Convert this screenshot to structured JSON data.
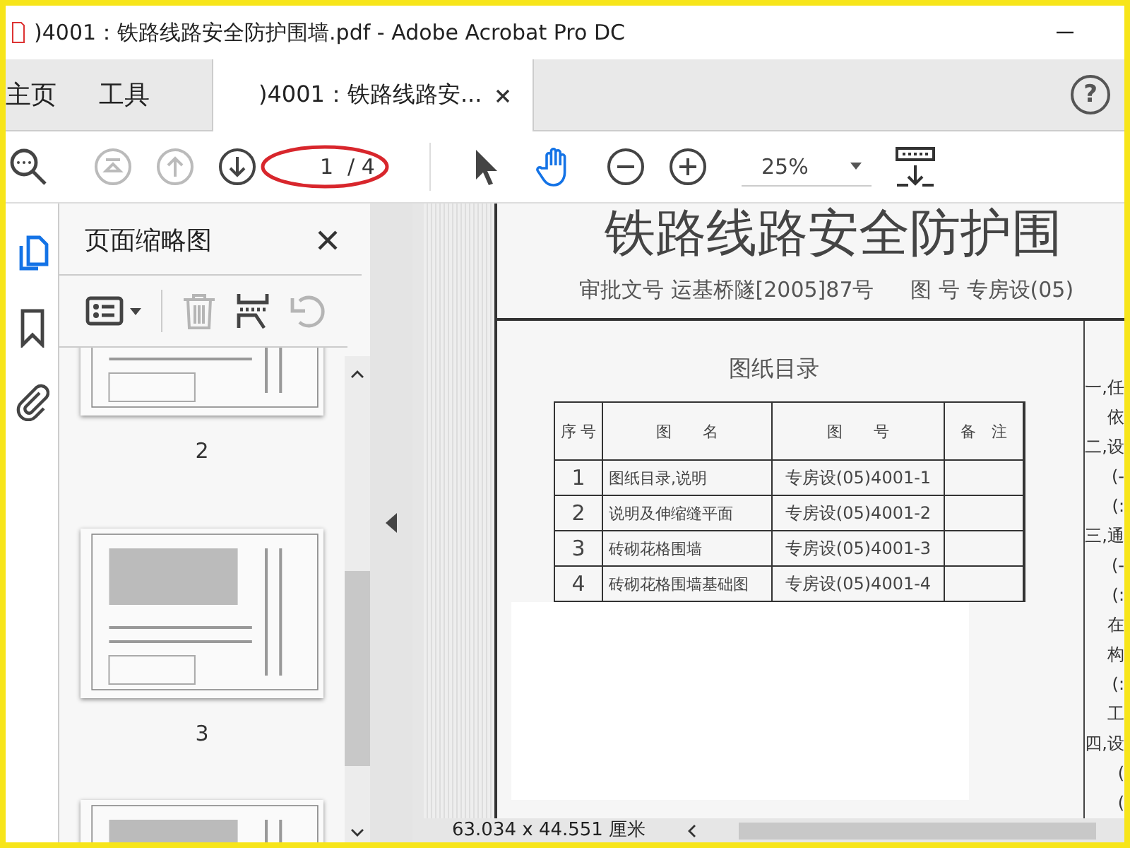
{
  "window": {
    "title": ")4001：铁路线路安全防护围墙.pdf - Adobe Acrobat Pro DC"
  },
  "tabs": [
    {
      "label": "主页",
      "kind": "nav",
      "selected": false
    },
    {
      "label": "工具",
      "kind": "nav",
      "selected": false
    },
    {
      "label": ")4001：铁路线路安...",
      "kind": "doc",
      "selected": true
    }
  ],
  "help_button": {
    "label": "?"
  },
  "toolbar": {
    "tools": [
      {
        "kind": "search",
        "disabled": false
      },
      {
        "kind": "first",
        "disabled": true
      },
      {
        "kind": "prev",
        "disabled": true
      },
      {
        "kind": "next",
        "disabled": false
      }
    ],
    "page_field": {
      "value": "1"
    },
    "page_total": "/ 4",
    "pointers": [
      {
        "kind": "select",
        "selected": false
      },
      {
        "kind": "hand",
        "selected": true
      }
    ],
    "zoom_buttons": [
      {
        "kind": "out"
      },
      {
        "kind": "in"
      }
    ],
    "zoom": "25%"
  },
  "rail": [
    {
      "kind": "pages",
      "selected": true
    },
    {
      "kind": "bookmarks",
      "selected": false
    },
    {
      "kind": "attachments",
      "selected": false
    }
  ],
  "panel": {
    "title": "页面缩略图",
    "tools": [
      {
        "kind": "options",
        "disabled": false
      },
      {
        "kind": "delete",
        "disabled": true
      },
      {
        "kind": "insert",
        "disabled": false
      },
      {
        "kind": "rotate",
        "disabled": true
      }
    ],
    "thumbnails": [
      {
        "label": "2",
        "selected": false
      },
      {
        "label": "3",
        "selected": false
      },
      {
        "selected": false
      }
    ]
  },
  "document": {
    "title": "铁路线路安全防护围",
    "approval": "审批文号  运基桥隧[2005]87号",
    "drawing_no": "图  号  专房设(05)",
    "table_title": "图纸目录",
    "table": {
      "columns": [
        "序 号",
        "图　　名",
        "图　　号",
        "备　注"
      ],
      "rows": [
        [
          "1",
          "图纸目录,说明",
          "专房设(05)4001-1"
        ],
        [
          "2",
          "说明及伸缩缝平面",
          "专房设(05)4001-2"
        ],
        [
          "3",
          "砖砌花格围墙",
          "专房设(05)4001-3"
        ],
        [
          "4",
          "砖砌花格围墙基础图",
          "专房设(05)4001-4"
        ]
      ]
    },
    "margin_notes": [
      "一,任",
      "依",
      "二,设",
      "(-",
      "(:",
      "三,通",
      "(-",
      "(:",
      "在",
      "构",
      "(:",
      "工",
      "四,设",
      "(",
      "("
    ]
  },
  "status": {
    "page_size": "63.034 x 44.551 厘米"
  }
}
